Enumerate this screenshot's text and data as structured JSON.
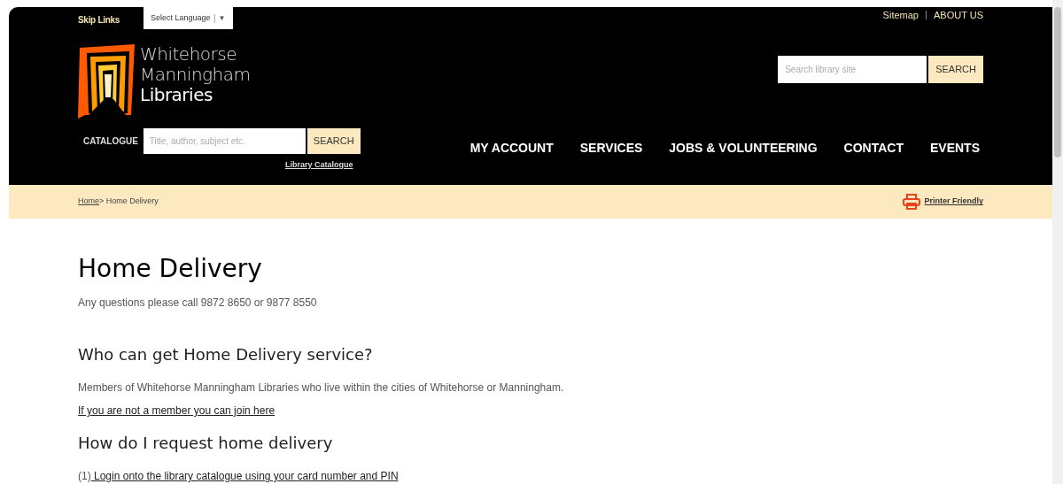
{
  "top_bar": {
    "skip_links": "Skip Links",
    "language_select": "Select Language",
    "language_caret": "▼",
    "links": [
      "Sitemap",
      "ABOUT US"
    ]
  },
  "logo": {
    "lines": [
      "Whitehorse",
      "Manningham",
      "Libraries"
    ]
  },
  "site_search": {
    "placeholder": "Search library site",
    "button": "SEARCH"
  },
  "catalogue_search": {
    "label": "CATALOGUE",
    "placeholder": "Title, author, subject etc.",
    "button": "SEARCH",
    "link": "Library Catalogue"
  },
  "nav": [
    "MY ACCOUNT",
    "SERVICES",
    "JOBS & VOLUNTEERING",
    "CONTACT",
    "EVENTS"
  ],
  "breadcrumb": {
    "home": "Home",
    "current": "> Home Delivery",
    "printer_friendly": "Printer Friendly"
  },
  "content": {
    "title": "Home Delivery",
    "intro": "Any questions please call 9872 8650 or 9877 8550",
    "sections": [
      {
        "heading": "Who can get Home Delivery service?",
        "lines": [
          {
            "kind": "text",
            "text": "Members of Whitehorse Manningham Libraries who live within the cities of Whitehorse or Manningham."
          },
          {
            "kind": "link",
            "text": "If you are not a member you can join here"
          }
        ]
      },
      {
        "heading": "How do I request home delivery",
        "lines": [
          {
            "kind": "numbered",
            "prefix": "(1)",
            "text": " Login onto the library catalogue using your card number and PIN"
          }
        ]
      }
    ]
  }
}
